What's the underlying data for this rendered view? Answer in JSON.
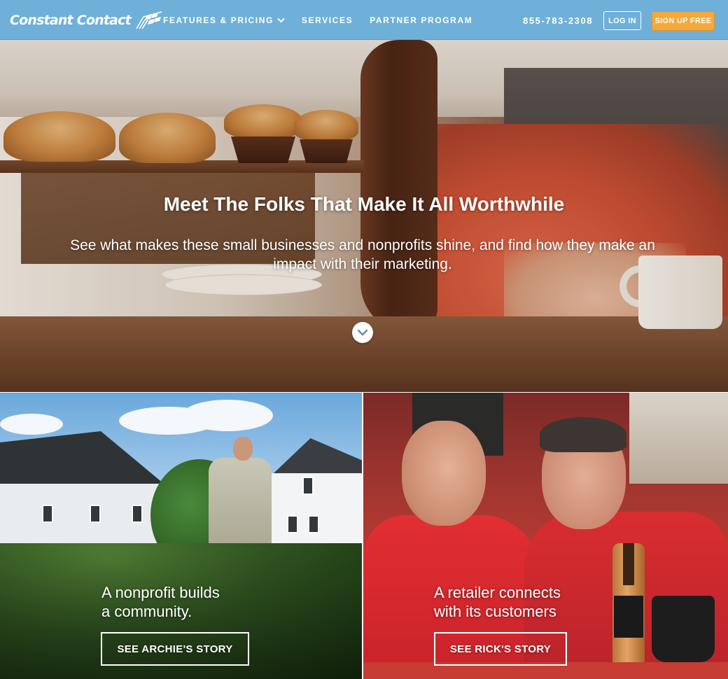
{
  "nav": {
    "brand": "Constant Contact",
    "links": [
      "FEATURES & PRICING",
      "SERVICES",
      "PARTNER PROGRAM"
    ],
    "phone": "855-783-2308",
    "login_label": "LOG IN",
    "signup_label": "SIGN UP FREE",
    "signup_color": "#f5a93a",
    "nav_color": "#6fb0d9"
  },
  "hero": {
    "title": "Meet The Folks That Make It All Worthwhile",
    "subtitle": "See what makes these small businesses and nonprofits shine, and find how they make an impact with their marketing.",
    "scroll_icon": "chevron-down-icon"
  },
  "stories": [
    {
      "line1": "A nonprofit builds",
      "line2": "a community.",
      "button": "SEE ARCHIE'S STORY"
    },
    {
      "line1": "A retailer connects",
      "line2": "with its customers",
      "button": "SEE RICK'S STORY"
    }
  ]
}
